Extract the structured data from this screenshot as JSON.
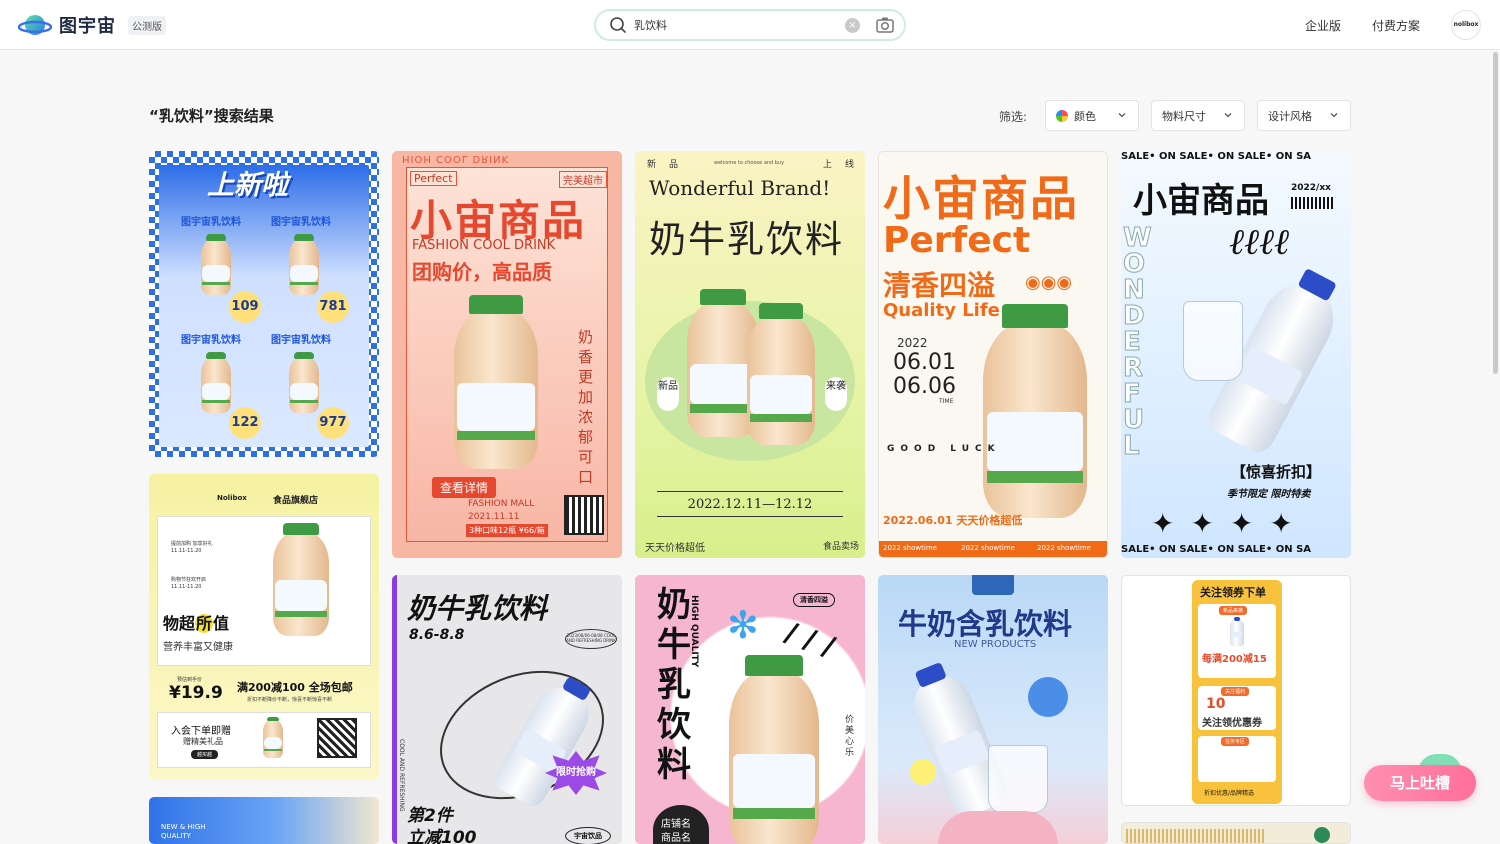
{
  "header": {
    "brand": "图宇宙",
    "beta_tag": "公测版",
    "search": {
      "value": "乳饮料",
      "placeholder": ""
    },
    "nav": {
      "enterprise": "企业版",
      "pricing": "付费方案"
    },
    "avatar_text": "nolibox"
  },
  "results": {
    "title": "“乳饮料”搜索结果",
    "filter_label": "筛选:",
    "filters": {
      "color": "颜色",
      "size": "物料尺寸",
      "style": "设计风格"
    }
  },
  "cards": {
    "c1": {
      "headline": "上新啦",
      "items": [
        "图宇宙乳饮料",
        "图宇宙乳饮料",
        "图宇宙乳饮料",
        "图宇宙乳饮料"
      ],
      "prices": [
        "109",
        "781",
        "122",
        "977"
      ]
    },
    "c2": {
      "edge": "HIOH COOL DRINK",
      "tag_left": "Perfect",
      "tag_right": "完美超市",
      "title": "小宙商品",
      "sub": "FASHION COOL DRINK",
      "slogan": "团购价，高品质",
      "side": "奶香更加浓郁可口",
      "button": "查看详情",
      "mall": "FASHION MALL",
      "date": "2021.11.11",
      "promo": "3种口味12瓶 ¥66/箱"
    },
    "c3": {
      "top": [
        "新",
        "品",
        "welcome to choose and buy",
        "上",
        "线"
      ],
      "brand": "Wonderful Brand!",
      "title": "奶牛乳饮料",
      "left_tag": "新品",
      "right_tag": "来袭",
      "date": "2022.12.11—12.12",
      "foot_left": "天天价格超低",
      "foot_right": "食品卖场"
    },
    "c4": {
      "title": "小宙商品",
      "perfect": "Perfect",
      "sub": "清香四溢",
      "quality": "Quality Life",
      "year": "2022",
      "date1": "06.01",
      "date2": "06.06",
      "time": "TIME",
      "good_luck": "GOOD LUCK",
      "bottom": "2022.06.01 天天价格超低",
      "showtime": [
        "2022 showtime",
        "2022 showtime",
        "2022 showtime"
      ]
    },
    "c5": {
      "ticker": "SALE• ON  SALE• ON  SALE• ON  SA",
      "title": "小宙商品",
      "code": "2022/xx",
      "vertical": "WONDERFUL",
      "tag": "【惊喜折扣】",
      "sub": "季节限定 限时特卖"
    },
    "c6": {
      "shop": "食品旗舰店",
      "brand": "Nolibox",
      "lines": [
        "提前加购 加享好礼",
        "11.11-11.20",
        "购物节狂欢开启",
        "11.11-11.20"
      ],
      "title_a": "物超",
      "title_b": "所",
      "title_c": "值",
      "sub": "营养丰富又健康",
      "price_tag": "预估到手价",
      "price": "¥19.9",
      "offer": "满200减100 全场包邮",
      "offer_sub": "折扣不断降价不断，惊喜不断惊喜不断",
      "member": "入会下单即赠",
      "member_sub": "赠精美礼品",
      "member_btn": "越买越"
    },
    "c7": {
      "title": "奶牛乳饮料",
      "date": "8.6-8.8",
      "pill": "2023/08/06-08/08 COOL AND REFRESHING DRINK",
      "side": "COOL AND REFRESHING",
      "burst": "限时抢购",
      "promo_a": "第2件",
      "promo_b": "立减100",
      "badge": "宇宙饮品"
    },
    "c8": {
      "title": "奶牛乳饮料",
      "vertical": "HIGH QUALITY",
      "pill": "清香四溢",
      "side": "价美心乐",
      "shop": "店铺名",
      "shop2": "商品名"
    },
    "c9": {
      "title": "牛奶含乳饮料",
      "sub": "NEW PRODUCTS"
    },
    "c10": {
      "top": "关注领券下单",
      "tag1": "新品来袭",
      "deal": "每满200减15",
      "tag2": "关注福利",
      "coupon_num": "10",
      "coupon": "关注领优惠券",
      "tag3": "任务专区",
      "bottom": "折扣优惠/品牌精选"
    },
    "c11": {
      "text": "NEW & HIGH QUALITY"
    }
  },
  "feedback": "马上吐槽",
  "colors": {
    "accent": "#34c98a",
    "pink": "#ff6f9b",
    "orange": "#f06a18",
    "blue": "#2f73e8"
  }
}
